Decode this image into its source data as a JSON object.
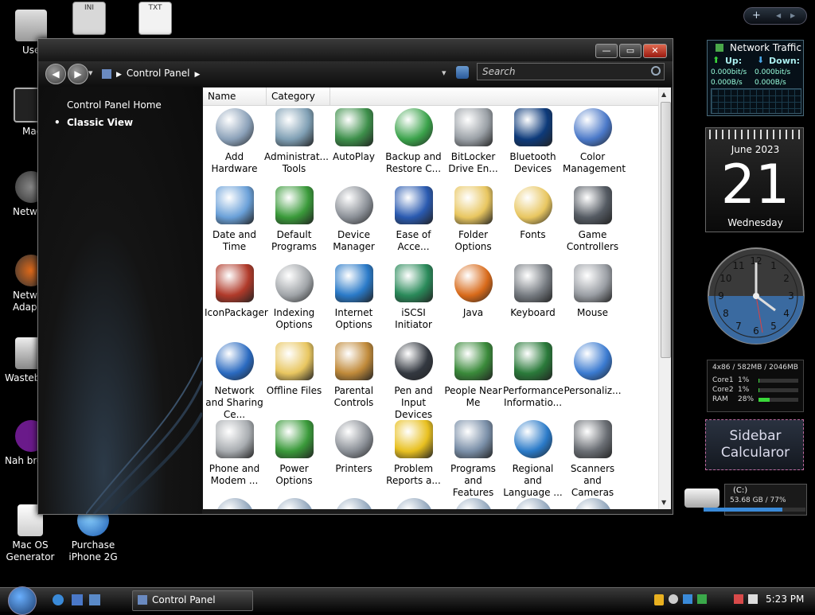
{
  "desktop": {
    "icons": [
      {
        "label": "Use"
      },
      {
        "label": "Mac"
      },
      {
        "label": "Netw"
      },
      {
        "label": "Netw Adap"
      },
      {
        "label": "Wasteb"
      },
      {
        "label": "Nah bro"
      },
      {
        "label": "Mac OS Generator"
      },
      {
        "label": "Purchase iPhone 2G"
      }
    ],
    "file_icons": [
      {
        "label": "INI"
      },
      {
        "label": "TXT"
      }
    ]
  },
  "window": {
    "title_buttons": {
      "minimize": "—",
      "maximize": "▭",
      "close": "✕"
    },
    "nav": {
      "back": "◀",
      "forward": "▶",
      "dropdown": "▾"
    },
    "breadcrumb": [
      "Control Panel"
    ],
    "search": {
      "placeholder": "Search"
    },
    "left_pane": {
      "home": "Control Panel Home",
      "classic": "Classic View"
    },
    "columns": [
      "Name",
      "Category"
    ],
    "items": [
      {
        "label": "Add Hardware",
        "icon": "add-hardware-icon",
        "color": "#8aa0b8"
      },
      {
        "label": "Administrat... Tools",
        "icon": "administrative-tools-icon",
        "color": "#7f9fb4"
      },
      {
        "label": "AutoPlay",
        "icon": "autoplay-icon",
        "color": "#3d8f4a"
      },
      {
        "label": "Backup and Restore C...",
        "icon": "backup-icon",
        "color": "#3aa24a"
      },
      {
        "label": "BitLocker Drive En...",
        "icon": "bitlocker-icon",
        "color": "#9aa0a6"
      },
      {
        "label": "Bluetooth Devices",
        "icon": "bluetooth-icon",
        "color": "#0d3a7a"
      },
      {
        "label": "Color Management",
        "icon": "color-management-icon",
        "color": "#4a78c8"
      },
      {
        "label": "Date and Time",
        "icon": "date-time-icon",
        "color": "#6aa0d8"
      },
      {
        "label": "Default Programs",
        "icon": "default-programs-icon",
        "color": "#3a9a3a"
      },
      {
        "label": "Device Manager",
        "icon": "device-manager-icon",
        "color": "#8a8f96"
      },
      {
        "label": "Ease of Acce...",
        "icon": "ease-of-access-icon",
        "color": "#2a5ab0"
      },
      {
        "label": "Folder Options",
        "icon": "folder-options-icon",
        "color": "#e8c660"
      },
      {
        "label": "Fonts",
        "icon": "fonts-icon",
        "color": "#e8c660"
      },
      {
        "label": "Game Controllers",
        "icon": "game-controllers-icon",
        "color": "#555b63"
      },
      {
        "label": "IconPackager",
        "icon": "iconpackager-icon",
        "color": "#b03a2a"
      },
      {
        "label": "Indexing Options",
        "icon": "indexing-options-icon",
        "color": "#a0a4a8"
      },
      {
        "label": "Internet Options",
        "icon": "internet-options-icon",
        "color": "#2a7ac8"
      },
      {
        "label": "iSCSI Initiator",
        "icon": "iscsi-initiator-icon",
        "color": "#2a8a5a"
      },
      {
        "label": "Java",
        "icon": "java-icon",
        "color": "#d86a1a"
      },
      {
        "label": "Keyboard",
        "icon": "keyboard-icon",
        "color": "#777c82"
      },
      {
        "label": "Mouse",
        "icon": "mouse-icon",
        "color": "#9a9ea4"
      },
      {
        "label": "Network and Sharing Ce...",
        "icon": "network-sharing-icon",
        "color": "#2a6ac0"
      },
      {
        "label": "Offline Files",
        "icon": "offline-files-icon",
        "color": "#e8c660"
      },
      {
        "label": "Parental Controls",
        "icon": "parental-controls-icon",
        "color": "#c08a3a"
      },
      {
        "label": "Pen and Input Devices",
        "icon": "pen-input-icon",
        "color": "#333840"
      },
      {
        "label": "People Near Me",
        "icon": "people-near-me-icon",
        "color": "#3a8a3a"
      },
      {
        "label": "Performance Informatio...",
        "icon": "performance-icon",
        "color": "#2a7a3a"
      },
      {
        "label": "Personaliz...",
        "icon": "personalization-icon",
        "color": "#3a7ad0"
      },
      {
        "label": "Phone and Modem ...",
        "icon": "phone-modem-icon",
        "color": "#a8acb0"
      },
      {
        "label": "Power Options",
        "icon": "power-options-icon",
        "color": "#3a9a3a"
      },
      {
        "label": "Printers",
        "icon": "printers-icon",
        "color": "#8a8f96"
      },
      {
        "label": "Problem Reports a...",
        "icon": "problem-reports-icon",
        "color": "#e8c020"
      },
      {
        "label": "Programs and Features",
        "icon": "programs-features-icon",
        "color": "#7a8fa8"
      },
      {
        "label": "Regional and Language ...",
        "icon": "regional-language-icon",
        "color": "#2a7ac8"
      },
      {
        "label": "Scanners and Cameras",
        "icon": "scanners-cameras-icon",
        "color": "#6a6e74"
      }
    ]
  },
  "gadgets": {
    "network": {
      "title": "Network Traffic",
      "up": "Up:",
      "down": "Down:",
      "up_bits": "0.000bit/s",
      "up_bytes": "0.000B/s",
      "down_bits": "0.000bit/s",
      "down_bytes": "0.000B/s"
    },
    "calendar": {
      "month": "June 2023",
      "day": "21",
      "weekday": "Wednesday"
    },
    "clock": {
      "numbers": [
        "12",
        "1",
        "2",
        "3",
        "4",
        "5",
        "6",
        "7",
        "8",
        "9",
        "10",
        "11"
      ]
    },
    "cpu": {
      "header": "4x86 / 582MB / 2046MB",
      "rows": [
        {
          "label": "Core1",
          "value": "1%",
          "pct": 1
        },
        {
          "label": "Core2",
          "value": "1%",
          "pct": 1
        },
        {
          "label": "RAM",
          "value": "28%",
          "pct": 28
        }
      ]
    },
    "calculator": {
      "label": "Sidebar Calcularor"
    },
    "drive": {
      "name": "(C:)",
      "info": "53.68 GB / 77%",
      "pct": 77
    },
    "sidebar_controls": {
      "add": "+",
      "prev": "◀",
      "next": "▶"
    }
  },
  "taskbar": {
    "window_label": "Control Panel",
    "clock": "5:23 PM"
  },
  "colors": {
    "window_bg": "#1a1a1a",
    "content_bg": "#ffffff",
    "accent": "#2a7ac8"
  }
}
